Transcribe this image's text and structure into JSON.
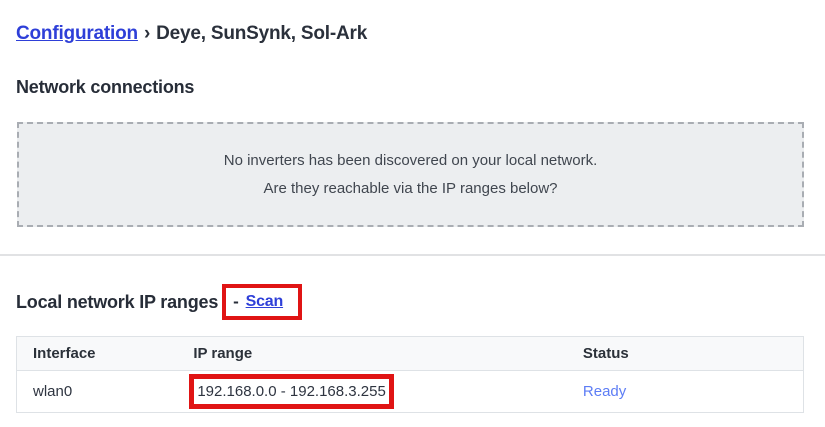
{
  "breadcrumb": {
    "link_label": "Configuration",
    "separator": "›",
    "current_page": "Deye, SunSynk, Sol-Ark"
  },
  "network_connections": {
    "title": "Network connections",
    "notice_line1": "No inverters has been discovered on your local network.",
    "notice_line2": "Are they reachable via the IP ranges below?"
  },
  "ip_ranges": {
    "title": "Local network IP ranges",
    "dash": "-",
    "scan_label": "Scan",
    "table": {
      "headers": [
        "Interface",
        "IP range",
        "Status"
      ],
      "rows": [
        {
          "interface": "wlan0",
          "ip_range": "192.168.0.0 - 192.168.3.255",
          "status": "Ready"
        }
      ]
    }
  },
  "colors": {
    "link_blue": "#2e3fd8",
    "status_blue": "#5d7df5",
    "annotation_red": "#e01414",
    "notice_background": "#eceef0",
    "table_border": "#dee2e6",
    "header_background": "#f8f9fa"
  }
}
